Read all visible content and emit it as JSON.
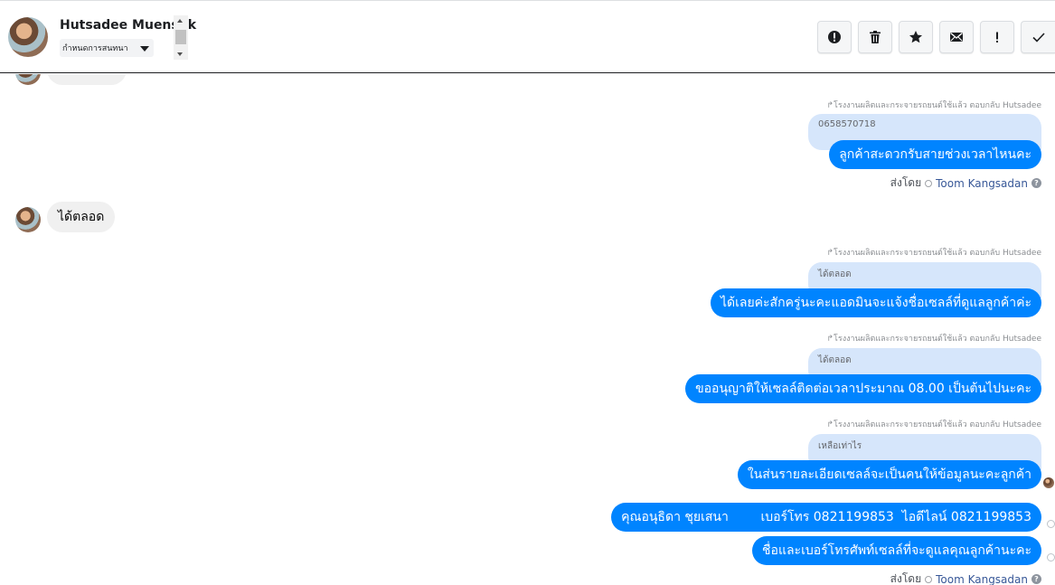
{
  "header": {
    "contact_name": "Hutsadee Muensuk",
    "label_select": "กำหนดการสนทนา",
    "toolbar": [
      {
        "name": "spam",
        "icon": "alert-circle-icon"
      },
      {
        "name": "delete",
        "icon": "trash-icon"
      },
      {
        "name": "star",
        "icon": "star-icon"
      },
      {
        "name": "mark-unread",
        "icon": "envelope-icon"
      },
      {
        "name": "follow-up",
        "icon": "exclamation-icon"
      },
      {
        "name": "done",
        "icon": "checkmark-icon"
      }
    ]
  },
  "thread": {
    "reply_meta": "โรงงานผลิตและกระจายรถยนต์ใช้แล้ว ตอบกลับ Hutsadee",
    "sent_by_label": "ส่งโดย",
    "agent_name": "Toom Kangsadan",
    "messages": [
      {
        "quoted": "0658570718",
        "text": "ลูกค้าสะดวกรับสายช่วงเวลาไหนคะ"
      },
      {
        "incoming": "ได้ตลอด"
      },
      {
        "quoted": "ได้ตลอด",
        "text": "ได้เลยค่ะสักครู่นะคะแอดมินจะแจ้งชื่อเซลล์ที่ดูแลลูกค้าค่ะ"
      },
      {
        "quoted": "ได้ตลอด",
        "text": "ขออนุญาติให้เซลล์ติดต่อเวลาประมาณ 08.00 เป็นต้นไปนะคะ"
      },
      {
        "quoted": "เหลือเท่าไร",
        "text": "ในส่นรายละเอียดเซลล์จะเป็นคนให้ข้อมูลนะคะลูกค้า"
      },
      {
        "text": "คุณอนุธิดา ชุยเสนา        เบอร์โทร 0821199853  ไอดีไลน์ 0821199853"
      },
      {
        "text": "ชื่อและเบอร์โทรศัพท์เซลล์ที่จะดูแลคุณลูกค้านะคะ"
      }
    ]
  },
  "colors": {
    "outgoing_bubble": "#0084ff",
    "quoted_bubble": "#d6e6fb",
    "incoming_bubble": "#f0f0f0"
  }
}
